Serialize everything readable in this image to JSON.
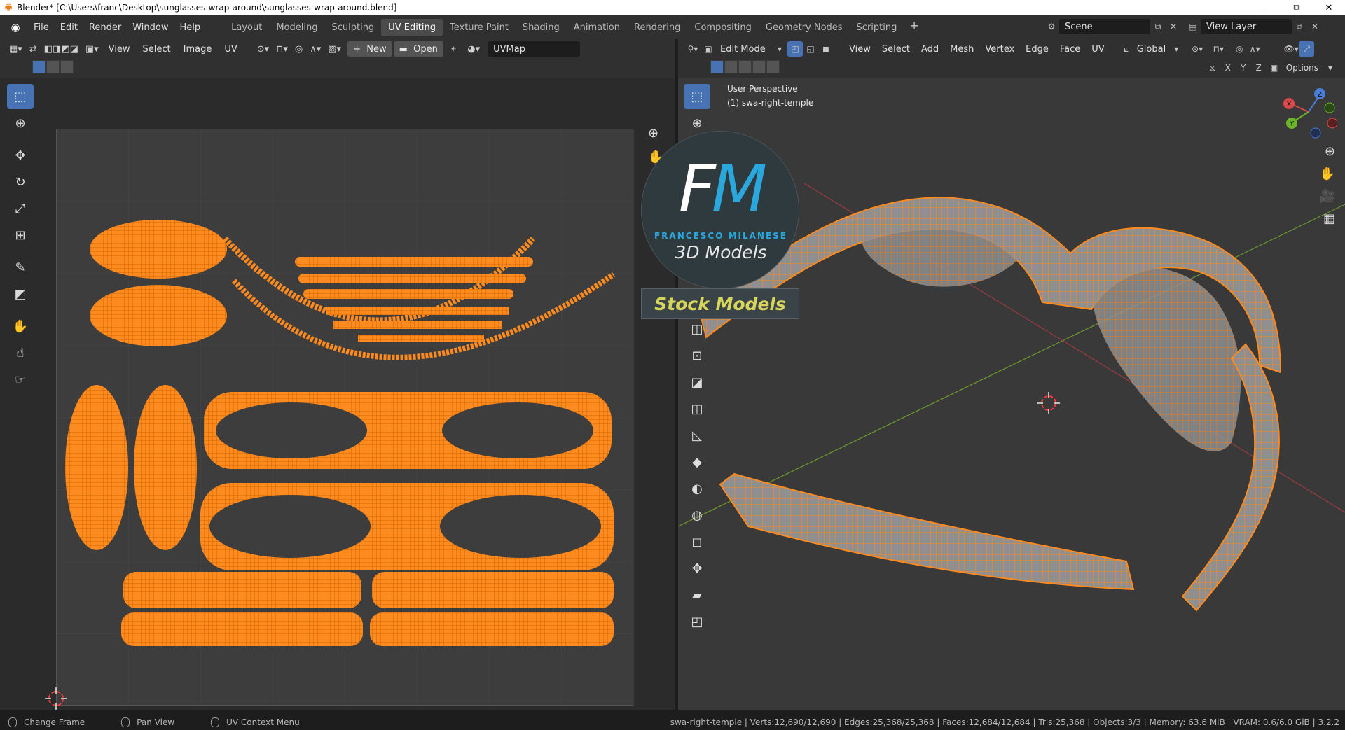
{
  "titlebar": {
    "title": "Blender* [C:\\Users\\franc\\Desktop\\sunglasses-wrap-around\\sunglasses-wrap-around.blend]",
    "minimize": "–",
    "maximize": "⧉",
    "close": "✕"
  },
  "menubar": {
    "menus": [
      "File",
      "Edit",
      "Render",
      "Window",
      "Help"
    ],
    "workspaces": [
      "Layout",
      "Modeling",
      "Sculpting",
      "UV Editing",
      "Texture Paint",
      "Shading",
      "Animation",
      "Rendering",
      "Compositing",
      "Geometry Nodes",
      "Scripting"
    ],
    "active_workspace": "UV Editing",
    "scene": "Scene",
    "view_layer": "View Layer"
  },
  "uv_editor": {
    "menus": [
      "View",
      "Select",
      "Image",
      "UV"
    ],
    "new_label": "New",
    "open_label": "Open",
    "uvmap": "UVMap"
  },
  "view3d": {
    "mode": "Edit Mode",
    "menus": [
      "View",
      "Select",
      "Add",
      "Mesh",
      "Vertex",
      "Edge",
      "Face",
      "UV"
    ],
    "orientation": "Global",
    "axes": [
      "X",
      "Y",
      "Z"
    ],
    "options": "Options",
    "overlay_line1": "User Perspective",
    "overlay_line2": "(1) swa-right-temple",
    "gizmo": {
      "x": "X",
      "y": "Y",
      "z": "Z"
    }
  },
  "watermark": {
    "logo_f": "F",
    "logo_m": "M",
    "subtitle": "FRANCESCO MILANESE",
    "tagline": "3D Models",
    "banner": "Stock Models"
  },
  "statusbar": {
    "hint1": "Change Frame",
    "hint2": "Pan View",
    "hint3": "UV Context Menu",
    "stats": "swa-right-temple | Verts:12,690/12,690 | Edges:25,368/25,368 | Faces:12,684/12,684 | Tris:25,368 | Objects:3/3 | Memory: 63.6 MiB | VRAM: 0.6/6.0 GiB | 3.2.2"
  },
  "colors": {
    "accent": "#4772b3",
    "mesh": "#ff8a1e",
    "panel": "#303030",
    "watermark_blue": "#2aa8dd",
    "watermark_yellow": "#d8d65a"
  }
}
